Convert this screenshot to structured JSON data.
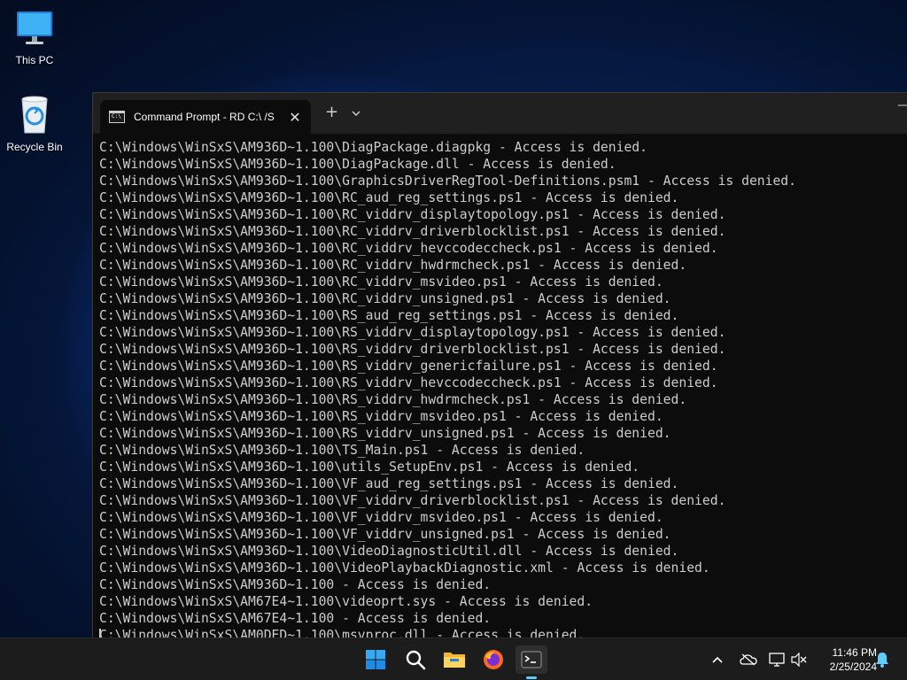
{
  "desktop": {
    "icons": [
      {
        "label": "This PC",
        "icon": "monitor-icon"
      },
      {
        "label": "Recycle Bin",
        "icon": "recycle-bin-icon"
      }
    ]
  },
  "terminal": {
    "tab_title": "Command Prompt - RD  C:\\ /S",
    "tab_icon_text": "C:\\",
    "new_tab_label": "+",
    "dropdown_label": "⌄",
    "close_label": "✕",
    "minimize_label": "—",
    "lines": [
      "C:\\Windows\\WinSxS\\AM936D~1.100\\DiagPackage.diagpkg - Access is denied.",
      "C:\\Windows\\WinSxS\\AM936D~1.100\\DiagPackage.dll - Access is denied.",
      "C:\\Windows\\WinSxS\\AM936D~1.100\\GraphicsDriverRegTool-Definitions.psm1 - Access is denied.",
      "C:\\Windows\\WinSxS\\AM936D~1.100\\RC_aud_reg_settings.ps1 - Access is denied.",
      "C:\\Windows\\WinSxS\\AM936D~1.100\\RC_viddrv_displaytopology.ps1 - Access is denied.",
      "C:\\Windows\\WinSxS\\AM936D~1.100\\RC_viddrv_driverblocklist.ps1 - Access is denied.",
      "C:\\Windows\\WinSxS\\AM936D~1.100\\RC_viddrv_hevccodeccheck.ps1 - Access is denied.",
      "C:\\Windows\\WinSxS\\AM936D~1.100\\RC_viddrv_hwdrmcheck.ps1 - Access is denied.",
      "C:\\Windows\\WinSxS\\AM936D~1.100\\RC_viddrv_msvideo.ps1 - Access is denied.",
      "C:\\Windows\\WinSxS\\AM936D~1.100\\RC_viddrv_unsigned.ps1 - Access is denied.",
      "C:\\Windows\\WinSxS\\AM936D~1.100\\RS_aud_reg_settings.ps1 - Access is denied.",
      "C:\\Windows\\WinSxS\\AM936D~1.100\\RS_viddrv_displaytopology.ps1 - Access is denied.",
      "C:\\Windows\\WinSxS\\AM936D~1.100\\RS_viddrv_driverblocklist.ps1 - Access is denied.",
      "C:\\Windows\\WinSxS\\AM936D~1.100\\RS_viddrv_genericfailure.ps1 - Access is denied.",
      "C:\\Windows\\WinSxS\\AM936D~1.100\\RS_viddrv_hevccodeccheck.ps1 - Access is denied.",
      "C:\\Windows\\WinSxS\\AM936D~1.100\\RS_viddrv_hwdrmcheck.ps1 - Access is denied.",
      "C:\\Windows\\WinSxS\\AM936D~1.100\\RS_viddrv_msvideo.ps1 - Access is denied.",
      "C:\\Windows\\WinSxS\\AM936D~1.100\\RS_viddrv_unsigned.ps1 - Access is denied.",
      "C:\\Windows\\WinSxS\\AM936D~1.100\\TS_Main.ps1 - Access is denied.",
      "C:\\Windows\\WinSxS\\AM936D~1.100\\utils_SetupEnv.ps1 - Access is denied.",
      "C:\\Windows\\WinSxS\\AM936D~1.100\\VF_aud_reg_settings.ps1 - Access is denied.",
      "C:\\Windows\\WinSxS\\AM936D~1.100\\VF_viddrv_driverblocklist.ps1 - Access is denied.",
      "C:\\Windows\\WinSxS\\AM936D~1.100\\VF_viddrv_msvideo.ps1 - Access is denied.",
      "C:\\Windows\\WinSxS\\AM936D~1.100\\VF_viddrv_unsigned.ps1 - Access is denied.",
      "C:\\Windows\\WinSxS\\AM936D~1.100\\VideoDiagnosticUtil.dll - Access is denied.",
      "C:\\Windows\\WinSxS\\AM936D~1.100\\VideoPlaybackDiagnostic.xml - Access is denied.",
      "C:\\Windows\\WinSxS\\AM936D~1.100 - Access is denied.",
      "C:\\Windows\\WinSxS\\AM67E4~1.100\\videoprt.sys - Access is denied.",
      "C:\\Windows\\WinSxS\\AM67E4~1.100 - Access is denied.",
      "C:\\Windows\\WinSxS\\AM0DED~1.100\\msvproc.dll - Access is denied."
    ]
  },
  "taskbar": {
    "apps": [
      {
        "name": "start-button",
        "icon": "windows-logo-icon",
        "active": false
      },
      {
        "name": "search-button",
        "icon": "search-icon",
        "active": false
      },
      {
        "name": "file-explorer-button",
        "icon": "folder-icon",
        "active": false
      },
      {
        "name": "firefox-button",
        "icon": "firefox-icon",
        "active": false
      },
      {
        "name": "terminal-button",
        "icon": "terminal-icon",
        "active": true
      }
    ],
    "tray": {
      "icons": [
        "chevron-up-icon",
        "onedrive-offline-icon",
        "network-icon",
        "volume-muted-icon",
        "notification-bell-icon"
      ],
      "time": "11:46 PM",
      "date": "2/25/2024"
    }
  },
  "colors": {
    "terminal_bg": "#0c0c0c",
    "terminal_text": "#cccccc",
    "titlebar_bg": "#202020",
    "taskbar_bg": "#1c1c1c",
    "accent": "#60cdff"
  }
}
